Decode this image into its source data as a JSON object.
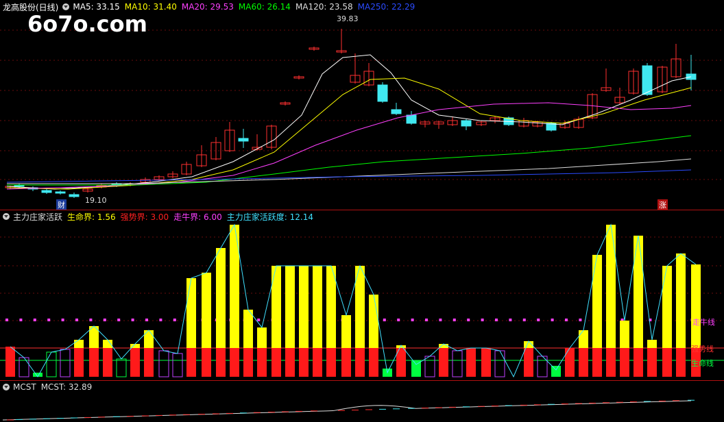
{
  "main": {
    "title": "龙高股份(日线)",
    "ma": [
      {
        "label": "MA5: 33.15",
        "color": "#ffffff"
      },
      {
        "label": "MA10: 31.40",
        "color": "#ffff00"
      },
      {
        "label": "MA20: 29.53",
        "color": "#ff40ff"
      },
      {
        "label": "MA60: 26.14",
        "color": "#00ff00"
      },
      {
        "label": "MA120: 23.58",
        "color": "#dddddd"
      },
      {
        "label": "MA250: 22.29",
        "color": "#2a4bff"
      }
    ],
    "logo": "6o7o.com",
    "high_mark": "39.83",
    "low_mark": "19.10",
    "badge_left": "财",
    "badge_right": "涨"
  },
  "indicator": {
    "name": "主力庄家活跃",
    "items": [
      {
        "label": "生命界: 1.56",
        "color": "#ffff00"
      },
      {
        "label": "强势界: 3.00",
        "color": "#ff2020"
      },
      {
        "label": "走牛界: 6.00",
        "color": "#ff40ff"
      },
      {
        "label": "主力庄家活跃度: 12.14",
        "color": "#40e0ff"
      }
    ],
    "line_labels": {
      "bull": "走牛线",
      "strong": "强势线",
      "life": "生命线"
    }
  },
  "mcst": {
    "name": "MCST",
    "value": "MCST: 32.89"
  },
  "colors": {
    "up": "#ff3030",
    "down": "#40e8f0",
    "bg": "#000000",
    "grid": "#7a1010"
  }
}
